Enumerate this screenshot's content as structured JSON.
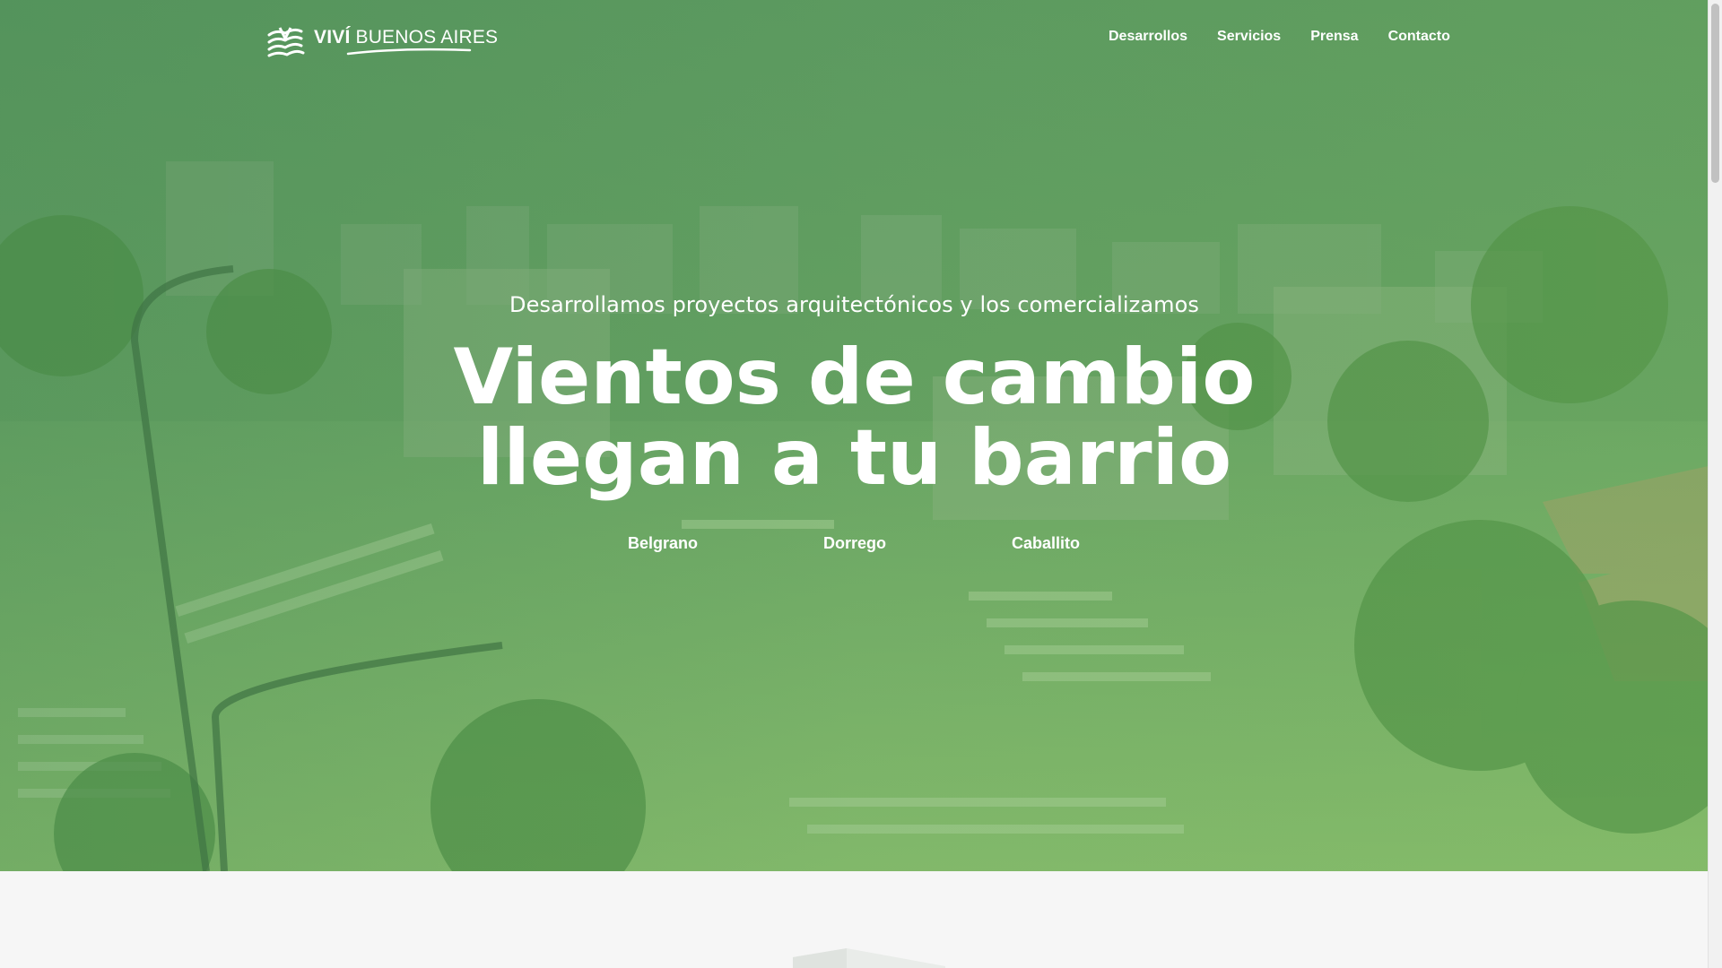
{
  "brand": {
    "name_strong": "VIVÍ",
    "name_light": "BUENOS AIRES"
  },
  "nav": {
    "items": [
      {
        "label": "Desarrollos"
      },
      {
        "label": "Servicios"
      },
      {
        "label": "Prensa"
      },
      {
        "label": "Contacto"
      }
    ]
  },
  "hero": {
    "kicker": "Desarrollamos proyectos arquitectónicos y los comercializamos",
    "title_line1": "Vientos de cambio",
    "title_line2": "llegan a tu barrio",
    "barrios": [
      {
        "label": "Belgrano"
      },
      {
        "label": "Dorrego"
      },
      {
        "label": "Caballito"
      }
    ]
  },
  "colors": {
    "overlay_green": "#6aa661",
    "text": "#ffffff",
    "below_bg": "#f6f6f6"
  }
}
